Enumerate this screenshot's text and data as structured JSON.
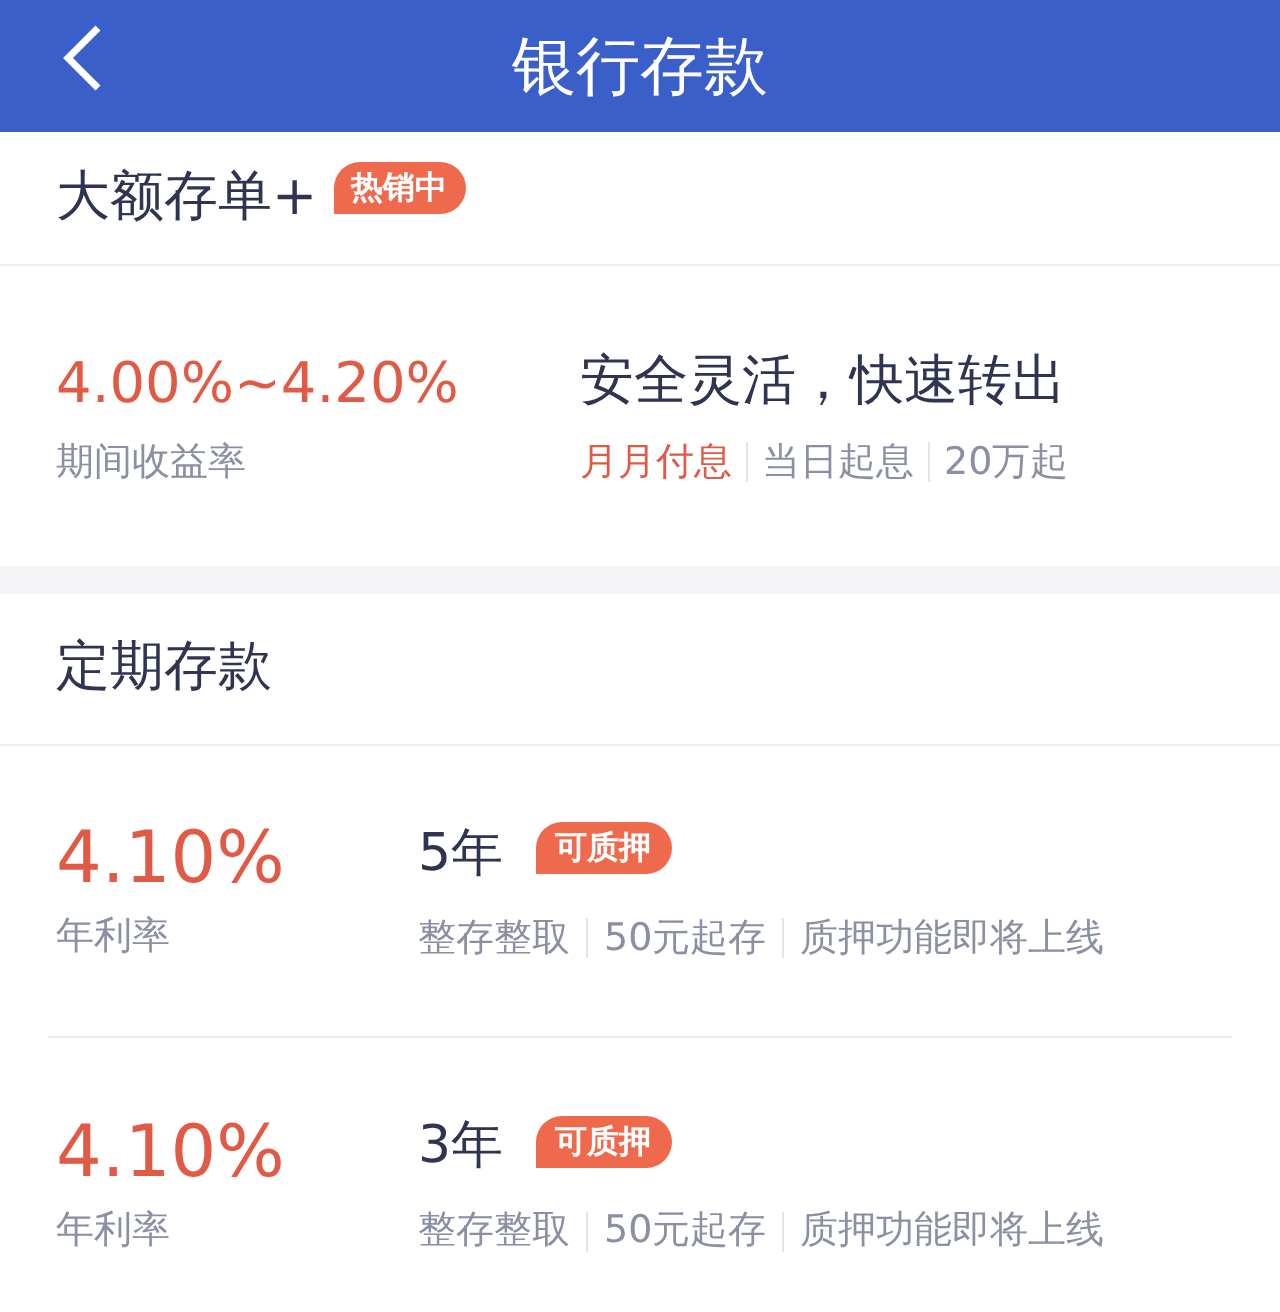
{
  "header": {
    "title": "银行存款"
  },
  "large_deposit": {
    "title": "大额存单+",
    "badge": "热销中",
    "rate": "4.00%~4.20%",
    "rate_label": "期间收益率",
    "slogan": "安全灵活，快速转出",
    "tags": [
      {
        "text": "月月付息",
        "highlighted": true
      },
      {
        "text": "当日起息",
        "highlighted": false
      },
      {
        "text": "20万起",
        "highlighted": false
      }
    ]
  },
  "fixed_deposit": {
    "title": "定期存款",
    "products": [
      {
        "rate": "4.10%",
        "rate_label": "年利率",
        "term": "5年",
        "badge": "可质押",
        "tags": [
          "整存整取",
          "50元起存",
          "质押功能即将上线"
        ]
      },
      {
        "rate": "4.10%",
        "rate_label": "年利率",
        "term": "3年",
        "badge": "可质押",
        "tags": [
          "整存整取",
          "50元起存",
          "质押功能即将上线"
        ]
      }
    ]
  }
}
